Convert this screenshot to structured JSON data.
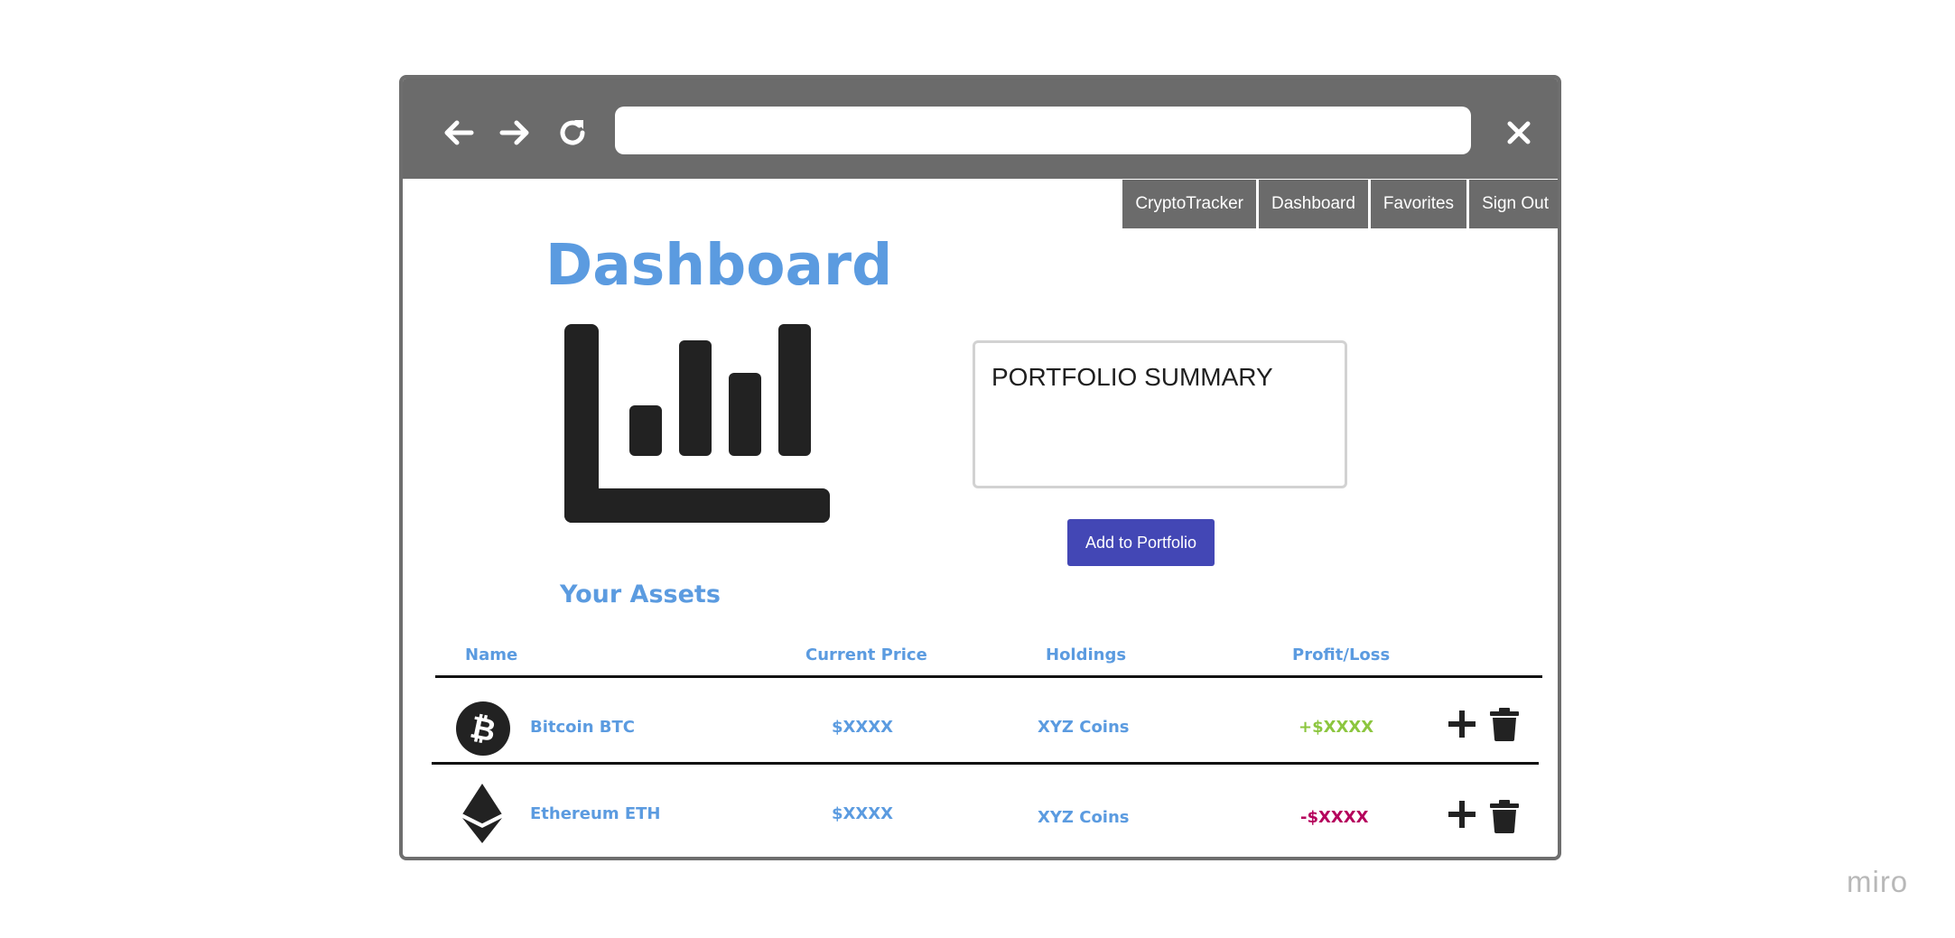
{
  "browser": {
    "url_value": ""
  },
  "nav_menu": [
    "CryptoTracker",
    "Dashboard",
    "Favorites",
    "Sign Out"
  ],
  "page_title": "Dashboard",
  "portfolio_summary": {
    "label": "PORTFOLIO SUMMARY"
  },
  "add_button": "Add to Portfolio",
  "assets": {
    "title": "Your Assets",
    "headers": {
      "name": "Name",
      "price": "Current Price",
      "holdings": "Holdings",
      "profit": "Profit/Loss"
    },
    "rows": [
      {
        "icon": "bitcoin-icon",
        "name": "Bitcoin BTC",
        "price": "$XXXX",
        "holdings": "XYZ Coins",
        "profit": "+$XXXX",
        "profit_color": "#8cc63f"
      },
      {
        "icon": "ethereum-icon",
        "name": "Ethereum ETH",
        "price": "$XXXX",
        "holdings": "XYZ Coins",
        "profit": "-$XXXX",
        "profit_color": "#b5005c"
      }
    ]
  },
  "watermark": "miro"
}
